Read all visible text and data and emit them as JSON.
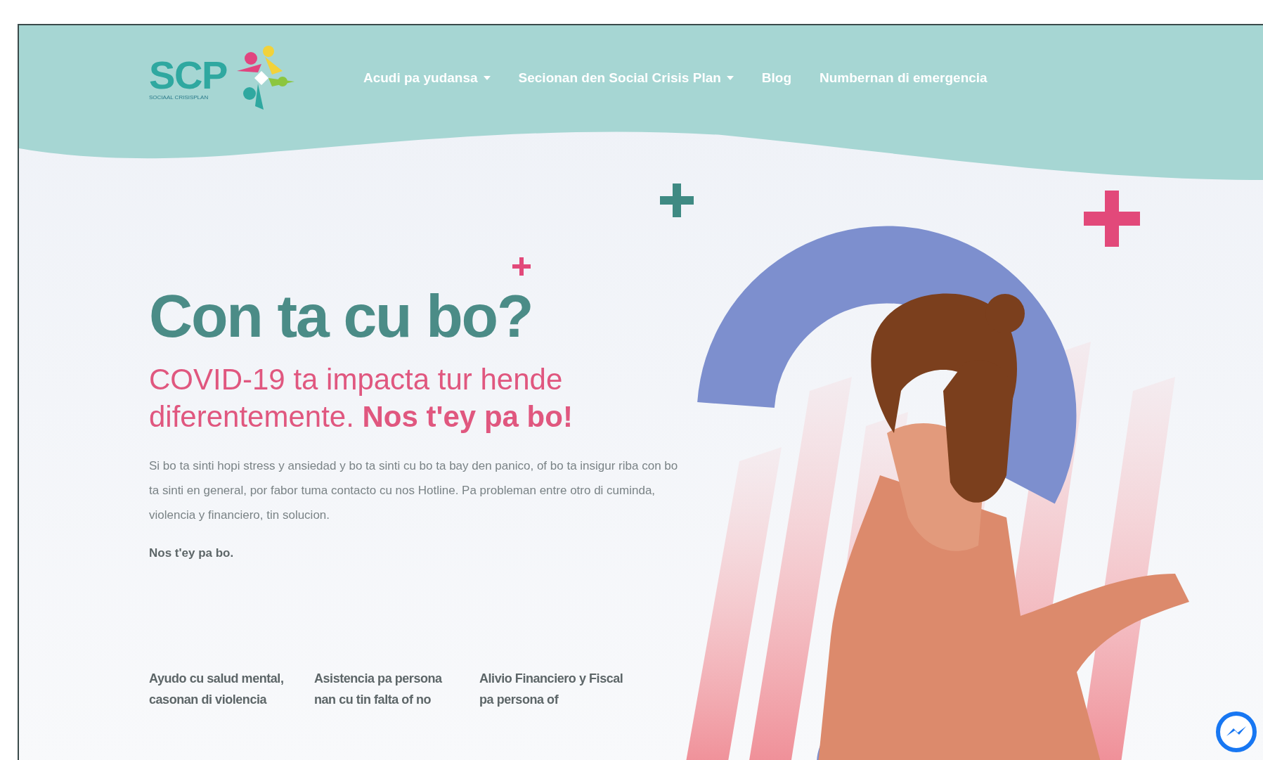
{
  "logo": {
    "text": "SCP",
    "tagline": "SOCIAAL CRISISPLAN"
  },
  "nav": [
    {
      "label": "Acudi pa yudansa",
      "dropdown": true
    },
    {
      "label": "Secionan den Social Crisis Plan",
      "dropdown": true
    },
    {
      "label": "Blog",
      "dropdown": false
    },
    {
      "label": "Numbernan di emergencia",
      "dropdown": false
    }
  ],
  "hero": {
    "title": "Con ta cu bo?",
    "subtitle": "COVID-19 ta impacta tur hende diferentemente. **Nos t'ey pa bo!**",
    "body": "Si bo ta sinti hopi stress y ansiedad y bo ta sinti cu bo ta bay den panico, of bo ta insigur riba con bo ta sinti en general, por fabor tuma contacto cu nos Hotline. Pa probleman entre otro di cuminda, violencia y financiero, tin solucion.",
    "closing": "Nos t'ey pa bo."
  },
  "services": [
    {
      "title": "Ayudo cu salud mental, casonan di violencia"
    },
    {
      "title": "Asistencia pa persona nan cu tin falta of no"
    },
    {
      "title": "Alivio Financiero y Fiscal pa persona of"
    }
  ]
}
